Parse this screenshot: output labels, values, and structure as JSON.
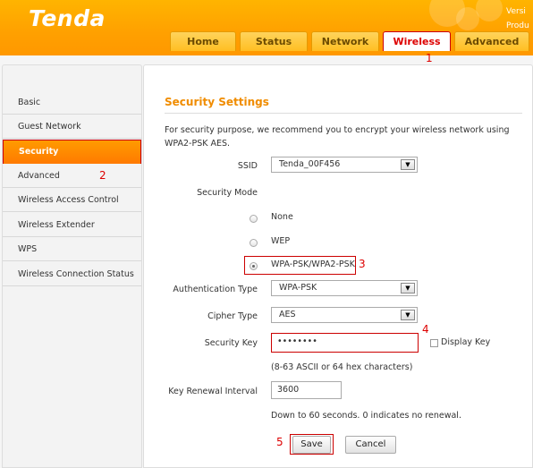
{
  "header": {
    "logo": "Tenda",
    "version_lines": [
      "Versi",
      "Produ"
    ],
    "tabs": [
      {
        "label": "Home"
      },
      {
        "label": "Status"
      },
      {
        "label": "Network"
      },
      {
        "label": "Wireless"
      },
      {
        "label": "Advanced"
      }
    ]
  },
  "annotations": {
    "n1": "1",
    "n2": "2",
    "n3": "3",
    "n4": "4",
    "n5": "5"
  },
  "sidebar": {
    "items": [
      {
        "label": "Basic"
      },
      {
        "label": "Guest Network"
      },
      {
        "label": "Security"
      },
      {
        "label": "Advanced"
      },
      {
        "label": "Wireless Access Control"
      },
      {
        "label": "Wireless Extender"
      },
      {
        "label": "WPS"
      },
      {
        "label": "Wireless Connection Status"
      }
    ]
  },
  "main": {
    "title": "Security Settings",
    "intro": "For security purpose, we recommend you to encrypt your wireless network using WPA2-PSK AES.",
    "ssid_label": "SSID",
    "ssid_value": "Tenda_00F456",
    "security_mode_label": "Security Mode",
    "mode_none": "None",
    "mode_wep": "WEP",
    "mode_wpa": "WPA-PSK/WPA2-PSK",
    "auth_label": "Authentication Type",
    "auth_value": "WPA-PSK",
    "cipher_label": "Cipher Type",
    "cipher_value": "AES",
    "key_label": "Security Key",
    "key_value": "••••••••",
    "display_key": "Display Key",
    "key_hint": "(8-63 ASCII or 64 hex characters)",
    "renewal_label": "Key Renewal Interval",
    "renewal_value": "3600",
    "renewal_hint": "Down to 60 seconds. 0 indicates no renewal.",
    "save": "Save",
    "cancel": "Cancel"
  },
  "colors": {
    "accent": "#ffa000",
    "title": "#f08c00",
    "highlight": "#cc0000"
  }
}
